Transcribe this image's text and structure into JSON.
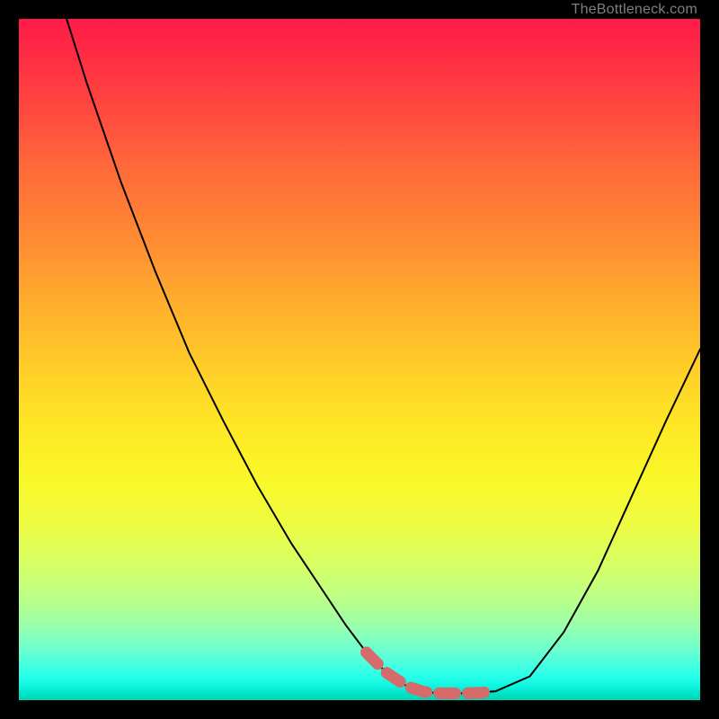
{
  "watermark": {
    "text": "TheBottleneck.com"
  },
  "chart_data": {
    "type": "line",
    "title": "",
    "xlabel": "",
    "ylabel": "",
    "xlim": [
      0,
      100
    ],
    "ylim": [
      0,
      100
    ],
    "series": [
      {
        "name": "main-curve",
        "color": "#000000",
        "x": [
          7,
          10,
          15,
          20,
          25,
          30,
          35,
          40,
          45,
          48,
          51,
          54,
          57,
          59.5,
          62,
          66,
          70,
          75,
          80,
          85,
          90,
          95,
          100
        ],
        "y": [
          100,
          90.5,
          76,
          63,
          51,
          41,
          31.5,
          23,
          15.5,
          11,
          7,
          4,
          2,
          1.2,
          1.0,
          1.0,
          1.3,
          3.5,
          10,
          19,
          30,
          41,
          51.5
        ]
      },
      {
        "name": "highlight-segment",
        "color": "#d66b6b",
        "x": [
          51,
          54,
          57,
          59.5,
          62,
          65,
          68,
          70
        ],
        "y": [
          7,
          4,
          2,
          1.2,
          1.0,
          1.0,
          1.1,
          1.3
        ]
      }
    ],
    "gradient_stops": [
      {
        "pos": 0,
        "color": "#ff1b49"
      },
      {
        "pos": 0.5,
        "color": "#ffd028"
      },
      {
        "pos": 0.75,
        "color": "#eefc42"
      },
      {
        "pos": 1.0,
        "color": "#00d6b8"
      }
    ]
  }
}
